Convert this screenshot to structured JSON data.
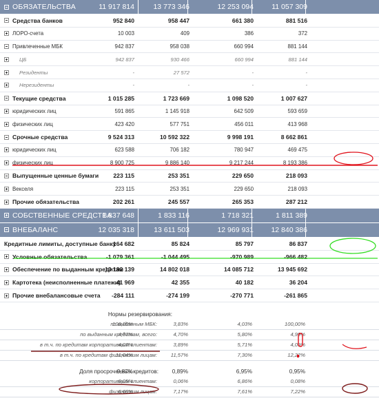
{
  "main_rows": [
    {
      "type": "header",
      "toggle": "minus",
      "label": "ОБЯЗАТЕЛЬСТВА",
      "values": [
        "11 917 814",
        "13 773 346",
        "12 253 094",
        "11 057 309"
      ]
    },
    {
      "type": "bold",
      "toggle": "minus",
      "label": "Средства банков",
      "values": [
        "952 840",
        "958 447",
        "661 380",
        "881 516"
      ]
    },
    {
      "type": "sub",
      "toggle": "plus",
      "label": "ЛОРО-счета",
      "values": [
        "10 003",
        "409",
        "386",
        "372"
      ]
    },
    {
      "type": "sub",
      "toggle": "minus",
      "label": "Привлеченные МБК",
      "values": [
        "942 837",
        "958 038",
        "660 994",
        "881 144"
      ]
    },
    {
      "type": "italic",
      "toggle": "plus",
      "label": "ЦБ",
      "values": [
        "942 837",
        "930 466",
        "660 994",
        "881 144"
      ]
    },
    {
      "type": "italic",
      "toggle": "plus",
      "label": "Резиденты",
      "values": [
        "-",
        "27 572",
        "-",
        "-"
      ]
    },
    {
      "type": "italic",
      "toggle": "plus",
      "label": "Нерезиденты",
      "values": [
        "-",
        "-",
        "-",
        "-"
      ]
    },
    {
      "type": "bold",
      "toggle": "minus",
      "label": "Текущие средства",
      "values": [
        "1 015 285",
        "1 723 669",
        "1 098 520",
        "1 007 627"
      ]
    },
    {
      "type": "sub",
      "toggle": "plus",
      "label": "юридических лиц",
      "values": [
        "591 865",
        "1 145 918",
        "642 509",
        "593 659"
      ]
    },
    {
      "type": "sub",
      "toggle": "plus",
      "label": "физических лиц",
      "values": [
        "423 420",
        "577 751",
        "456 011",
        "413 968"
      ]
    },
    {
      "type": "bold",
      "toggle": "minus",
      "label": "Срочные средства",
      "values": [
        "9 524 313",
        "10 592 322",
        "9 998 191",
        "8 662 861"
      ]
    },
    {
      "type": "sub",
      "toggle": "plus",
      "label": "юридических лиц",
      "values": [
        "623 588",
        "706 182",
        "780 947",
        "469 475"
      ]
    },
    {
      "type": "sub",
      "toggle": "plus",
      "label": "физических лиц",
      "values": [
        "8 900 725",
        "9 886 140",
        "9 217 244",
        "8 193 386"
      ]
    },
    {
      "type": "bold",
      "toggle": "minus",
      "label": "Выпущенные ценные бумаги",
      "values": [
        "223 115",
        "253 351",
        "229 650",
        "218 093"
      ]
    },
    {
      "type": "sub",
      "toggle": "plus",
      "label": "Векселя",
      "values": [
        "223 115",
        "253 351",
        "229 650",
        "218 093"
      ]
    },
    {
      "type": "bold",
      "toggle": "plus",
      "label": "Прочие обязательства",
      "values": [
        "202 261",
        "245 557",
        "265 353",
        "287 212"
      ]
    },
    {
      "type": "header",
      "toggle": "plus",
      "label": "СОБСТВЕННЫЕ СРЕДСТВА",
      "values": [
        "1 837 648",
        "1 833 116",
        "1 718 321",
        "1 811 389"
      ]
    },
    {
      "type": "header",
      "toggle": "minus",
      "label": "ВНЕБАЛАНС",
      "values": [
        "12 035 318",
        "13 611 503",
        "12 969 931",
        "12 840 386"
      ]
    },
    {
      "type": "bold",
      "toggle": "none",
      "label": "Кредитные лимиты, доступные банку",
      "values": [
        "164 682",
        "85 824",
        "85 797",
        "86 837"
      ]
    },
    {
      "type": "bold",
      "toggle": "plus",
      "label": "Условные обязательства",
      "values": [
        "-1 079 361",
        "-1 044 495",
        "-970 989",
        "-966 482"
      ]
    },
    {
      "type": "bold",
      "toggle": "plus",
      "label": "Обеспечение по выданным кредитам",
      "values": [
        "13 192 139",
        "14 802 018",
        "14 085 712",
        "13 945 692"
      ]
    },
    {
      "type": "bold",
      "toggle": "plus",
      "label": "Картотека (неисполненные платежи)",
      "values": [
        "41 969",
        "42 355",
        "40 182",
        "36 204"
      ]
    },
    {
      "type": "bold",
      "toggle": "plus",
      "label": "Прочие внебалансовые счета",
      "values": [
        "-284 111",
        "-274 199",
        "-270 771",
        "-261 865"
      ]
    }
  ],
  "reserve_section": {
    "title": "Нормы резервирования:",
    "rows": [
      {
        "label": "по выданным МБК:",
        "values": [
          "100,00%",
          "3,83%",
          "4,03%",
          "100,00%"
        ]
      },
      {
        "label": "по выданным кредитам, всего:",
        "values": [
          "4,87%",
          "4,70%",
          "5,80%",
          "4,99%"
        ]
      },
      {
        "label": "в т.ч. по кредитам корпоративным клиентам:",
        "values": [
          "4,07%",
          "3,89%",
          "5,71%",
          "4,09%"
        ]
      },
      {
        "label": "в т.ч. по кредитам физическим лицам:",
        "values": [
          "11,04%",
          "11,57%",
          "7,30%",
          "12,22%"
        ]
      }
    ]
  },
  "overdue_section": {
    "title": "Доля просроченных кредитов:",
    "title_values": [
      "0,87%",
      "0,89%",
      "6,95%",
      "0,95%"
    ],
    "rows": [
      {
        "label": "корпоративным клиентам:",
        "values": [
          "0,05%",
          "0,06%",
          "6,86%",
          "0,08%"
        ]
      },
      {
        "label": "физическим лицам:",
        "values": [
          "6,60%",
          "7,17%",
          "7,61%",
          "7,22%"
        ]
      }
    ]
  },
  "colors": {
    "header_bg": "#7d8fab",
    "annotation_red": "#e0121b",
    "annotation_dark_red": "#7c1a1a",
    "annotation_green": "#33dd22"
  }
}
